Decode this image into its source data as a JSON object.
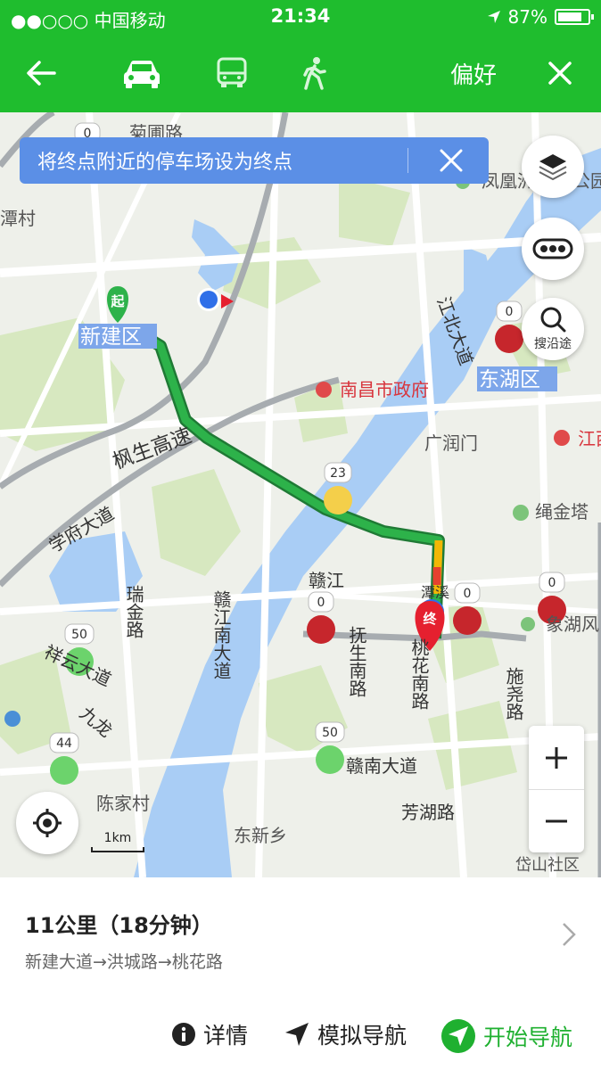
{
  "status_bar": {
    "carrier": "●●○○○ 中国移动",
    "time": "21:34",
    "battery": "87%"
  },
  "nav": {
    "back_icon": "arrow-left-icon",
    "modes": [
      "car-icon",
      "bus-icon",
      "walk-icon"
    ],
    "preference_label": "偏好",
    "close_icon": "close-icon"
  },
  "map": {
    "banner_text": "将终点附近的停车场设为终点",
    "search_along_label": "搜沿途",
    "scale_label": "1km",
    "start_marker": "起",
    "end_marker": "终",
    "places": {
      "p1": "菊圃路",
      "p2": "凤凰洲",
      "p3": "公园",
      "p4": "潭村",
      "p5": "新建区",
      "p6": "南昌市政府",
      "p7": "东湖区",
      "p8": "枫生高速",
      "p9": "广润门",
      "p10": "江西",
      "p11": "学府大道",
      "p12": "绳金塔",
      "p13": "赣江",
      "p14": "瑞金路",
      "p15": "赣江南大道",
      "p16": "抚生南路",
      "p17": "桃花南路",
      "p18": "象湖风",
      "p19": "施尧路",
      "p20": "祥云大道",
      "p21": "九龙",
      "p22": "陈家村",
      "p23": "东新乡",
      "p24": "赣南大道",
      "p25": "芳湖路",
      "p26": "岱山社区",
      "p27": "江北大道",
      "p28": "潭溪"
    },
    "traffic_badges": {
      "b1": "0",
      "b2": "0",
      "b3": "23",
      "b4": "0",
      "b5": "0",
      "b6": "0",
      "b7": "50",
      "b8": "44",
      "b9": "50"
    },
    "colors": {
      "route": "#2db24a",
      "water": "#a9cdf5",
      "green_area": "#d7e8c0",
      "road": "#ffffff",
      "highway": "#a7acb0"
    }
  },
  "route": {
    "summary": "11公里（18分钟）",
    "via": "新建大道→洪城路→桃花路"
  },
  "actions": {
    "details": "详情",
    "simulate": "模拟导航",
    "start": "开始导航"
  }
}
